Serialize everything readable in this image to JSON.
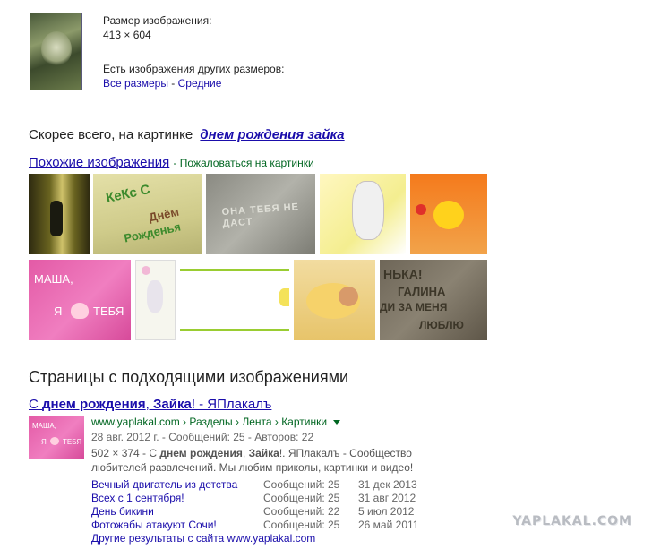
{
  "image_info": {
    "size_label": "Размер изображения:",
    "size_value": "413 × 604",
    "other_sizes_label": "Есть изображения других размеров:",
    "all_sizes_link": "Все размеры",
    "separator": " - ",
    "medium_link": "Средние"
  },
  "best_guess": {
    "prefix": "Скорее всего, на картинке",
    "query": "днем рождения зайка"
  },
  "similar": {
    "title": "Похожие изображения",
    "report": "Пожаловаться на картинки",
    "thumb_texts": {
      "keks": "КеКс С",
      "keks2": "Днём",
      "keks3": "Рожденья",
      "sand": "ОНА ТЕБЯ НЕ ДАСТ",
      "masha1": "МАША,",
      "masha2": "Я",
      "masha3": "ТЕБЯ",
      "sand2a": "НЬКА!",
      "sand2b": "ГАЛИНА",
      "sand2c": "ДИ ЗА МЕНЯ",
      "sand2d": "ЛЮБЛЮ"
    }
  },
  "pages": {
    "heading": "Страницы с подходящими изображениями",
    "result": {
      "title_pre": "С ",
      "title_b1": "днем рождения",
      "title_mid": ", ",
      "title_b2": "Зайка",
      "title_post": "! - ЯПлакалъ",
      "url": "www.yaplakal.com › Разделы › Лента › Картинки",
      "meta": "28 авг. 2012 г. - Сообщений: 25 - Авторов: 22",
      "snippet_pre": "502 × 374 - С ",
      "snippet_b1": "днем рождения",
      "snippet_mid": ", ",
      "snippet_b2": "Зайка",
      "snippet_post": "!. ЯПлакалъ - Сообщество",
      "snippet_line2": "любителей развлечений. Мы любим приколы, картинки и видео!",
      "thumb_text1": "МАША,",
      "thumb_text2": "Я",
      "thumb_text3": "ТЕБЯ"
    },
    "sub_results": [
      {
        "title": "Вечный двигатель из детства",
        "count": "Сообщений: 25",
        "date": "31 дек 2013"
      },
      {
        "title": "Всех с 1 сентября!",
        "count": "Сообщений: 25",
        "date": "31 авг 2012"
      },
      {
        "title": "День бикини",
        "count": "Сообщений: 22",
        "date": "5 июл 2012"
      },
      {
        "title": "Фотожабы атакуют Сочи!",
        "count": "Сообщений: 25",
        "date": "26 май 2011"
      }
    ],
    "more_results": "Другие результаты с сайта www.yaplakal.com"
  },
  "watermark": "YAPLAKAL.COM",
  "colors": {
    "link": "#1a0dab",
    "url_green": "#006621",
    "meta_gray": "#666666"
  }
}
